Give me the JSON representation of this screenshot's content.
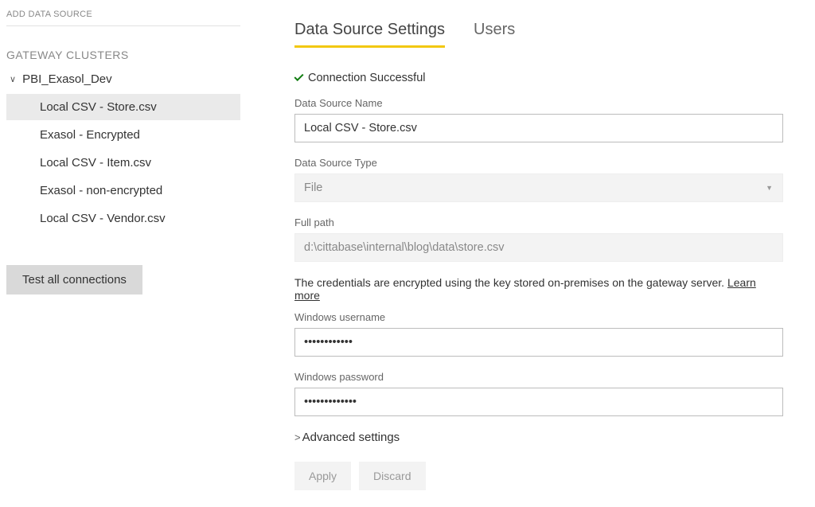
{
  "sidebar": {
    "addHeader": "ADD DATA SOURCE",
    "sectionTitle": "GATEWAY CLUSTERS",
    "gatewayName": "PBI_Exasol_Dev",
    "items": [
      {
        "label": "Local CSV - Store.csv",
        "selected": true
      },
      {
        "label": "Exasol - Encrypted",
        "selected": false
      },
      {
        "label": "Local CSV - Item.csv",
        "selected": false
      },
      {
        "label": "Exasol - non-encrypted",
        "selected": false
      },
      {
        "label": "Local CSV - Vendor.csv",
        "selected": false
      }
    ],
    "testButton": "Test all connections"
  },
  "tabs": {
    "settings": "Data Source Settings",
    "users": "Users"
  },
  "status": {
    "text": "Connection Successful"
  },
  "form": {
    "dsNameLabel": "Data Source Name",
    "dsNameValue": "Local CSV - Store.csv",
    "dsTypeLabel": "Data Source Type",
    "dsTypeValue": "File",
    "fullPathLabel": "Full path",
    "fullPathValue": "d:\\cittabase\\internal\\blog\\data\\store.csv",
    "credHelper": "The credentials are encrypted using the key stored on-premises on the gateway server. ",
    "learnMore": "Learn more",
    "winUserLabel": "Windows username",
    "winUserValue": "••••••••••••",
    "winPassLabel": "Windows password",
    "winPassValue": "•••••••••••••",
    "advanced": "Advanced settings",
    "apply": "Apply",
    "discard": "Discard"
  }
}
